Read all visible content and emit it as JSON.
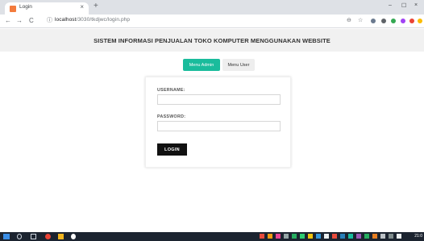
{
  "browser": {
    "tab_title": "Login",
    "tab_close": "×",
    "new_tab": "+",
    "nav_back": "←",
    "nav_forward": "→",
    "nav_reload": "C",
    "url_host": "localhost",
    "url_path": "/3030/tkdjwc/login.php",
    "win_min": "–",
    "win_max": "☐",
    "win_close": "×",
    "icons": [
      "zoom-icon",
      "star-icon",
      "extension-icon",
      "extension-icon",
      "extension-icon",
      "extension-icon",
      "extension-icon",
      "extension-icon",
      "profile-icon"
    ]
  },
  "site": {
    "title": "SISTEM INFORMASI PENJUALAN TOKO KOMPUTER MENGGUNAKAN WEBSITE"
  },
  "menu": {
    "admin_label": "Menu Admin",
    "user_label": "Menu User"
  },
  "form": {
    "username_label": "USERNAME:",
    "username_value": "",
    "password_label": "PASSWORD:",
    "password_value": "",
    "login_label": "LOGIN"
  },
  "colors": {
    "accent": "#1abc9c",
    "login_button": "#111111",
    "header_bg": "#f1f1f1",
    "taskbar": "#1c2430"
  },
  "taskbar": {
    "icons": [
      "windows-start-icon",
      "search-icon",
      "task-view-icon",
      "chrome-icon",
      "file-explorer-icon",
      "app-icon"
    ],
    "clock": "21:0"
  }
}
